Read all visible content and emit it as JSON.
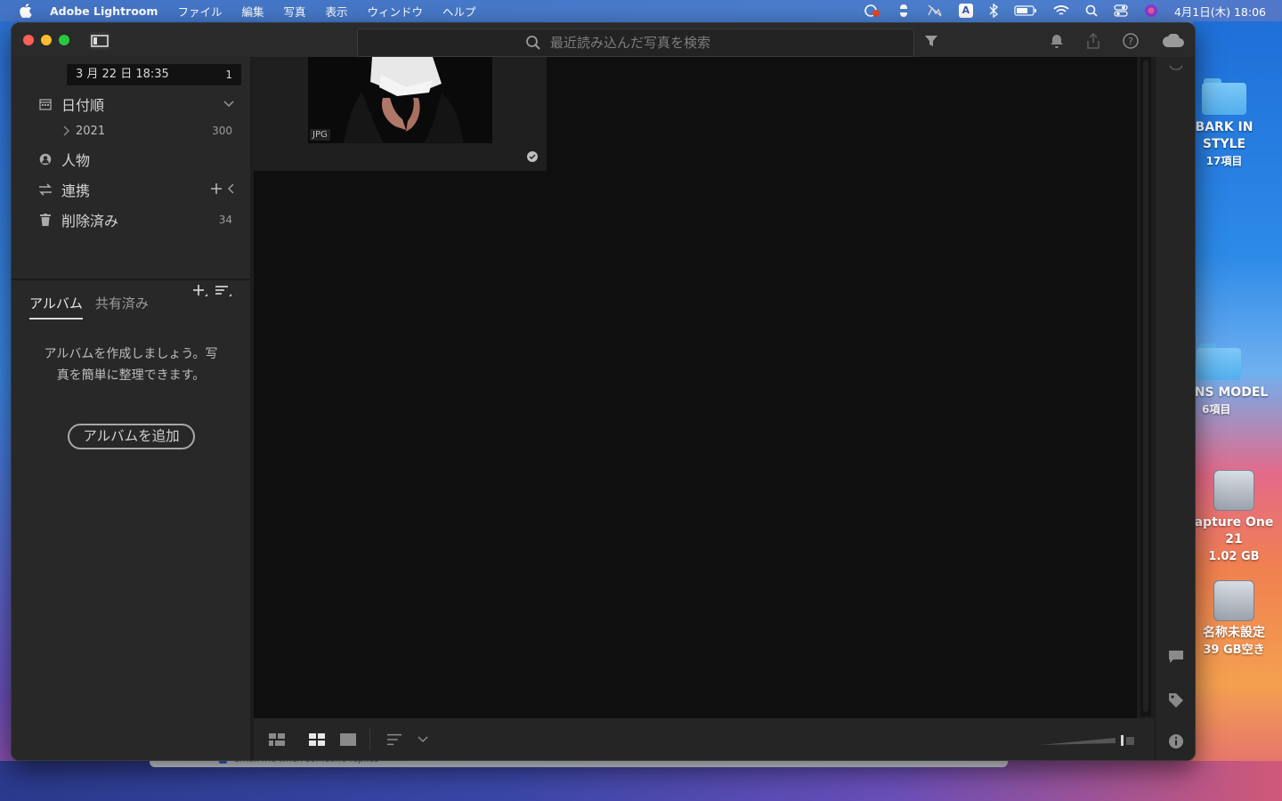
{
  "menubar": {
    "app_name": "Adobe Lightroom",
    "items": [
      "ファイル",
      "編集",
      "写真",
      "表示",
      "ウィンドウ",
      "ヘルプ"
    ],
    "ime_label": "A",
    "clock": "4月1日(木) 18:06"
  },
  "desktop": {
    "icons": [
      {
        "line1": "BARK IN",
        "line2": "STYLE",
        "line3": "17項目"
      },
      {
        "line1": "NS MODEL",
        "line2": "6項目"
      },
      {
        "line1": "apture One",
        "line2": "21",
        "line3": "1.02 GB"
      },
      {
        "line1": "名称未設定",
        "line2": "39 GB空き"
      }
    ],
    "behind_window_text": "Email me when someone replies"
  },
  "toolbar": {
    "search_placeholder": "最近読み込んだ写真を検索"
  },
  "sidebar": {
    "date_tooltip": {
      "label": "3 月 22 日 18:35",
      "count": "1"
    },
    "items": [
      {
        "label": "日付順"
      },
      {
        "label": "2021",
        "count": "300"
      },
      {
        "label": "人物"
      },
      {
        "label": "連携"
      },
      {
        "label": "削除済み",
        "count": "34"
      }
    ],
    "album_tabs": [
      "アルバム",
      "共有済み"
    ],
    "album_empty_message": "アルバムを作成しましょう。写真を簡単に整理できます。",
    "add_album_button": "アルバムを追加"
  },
  "grid": {
    "photo_badge": "JPG"
  },
  "colors": {
    "window_bg": "#1d1d1d",
    "sidebar_bg": "#282828",
    "grid_bg": "#0f0f0f",
    "close": "#fe5f57",
    "minimize": "#febc2e",
    "maximize": "#28c840"
  }
}
